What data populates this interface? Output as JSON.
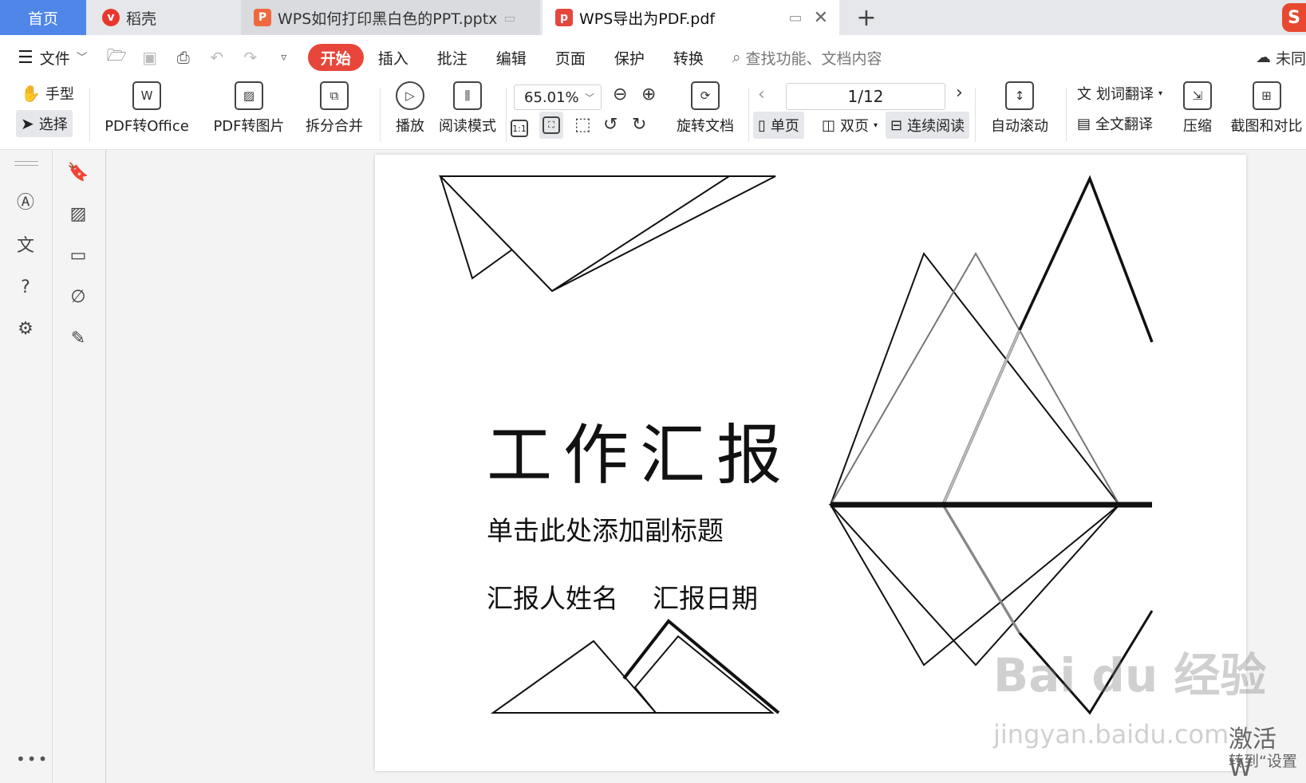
{
  "tabs": {
    "home": "首页",
    "daoke": "稻壳",
    "pptx": "WPS如何打印黑白色的PPT.pptx",
    "pdf": "WPS导出为PDF.pdf",
    "new_tab": "+"
  },
  "menu": {
    "file": "文件",
    "items": [
      "开始",
      "插入",
      "批注",
      "编辑",
      "页面",
      "保护",
      "转换"
    ],
    "search_placeholder": "查找功能、文档内容",
    "cloud": "未同"
  },
  "ribbon": {
    "hand": "手型",
    "select": "选择",
    "pdf_to_office": "PDF转Office",
    "pdf_to_image": "PDF转图片",
    "split_merge": "拆分合并",
    "play": "播放",
    "read_mode": "阅读模式",
    "zoom": "65.01%",
    "rotate": "旋转文档",
    "page_indicator": "1/12",
    "single": "单页",
    "double": "双页",
    "continuous": "连续阅读",
    "auto_scroll": "自动滚动",
    "word_translate": "划词翻译",
    "full_translate": "全文翻译",
    "compress": "压缩",
    "screenshot_compare": "截图和对比",
    "fit_label": "1:1"
  },
  "slide": {
    "title": "工作汇报",
    "subtitle": "单击此处添加副标题",
    "reporter": "汇报人姓名",
    "date": "汇报日期"
  },
  "overlay": {
    "watermark": "Bai du 经验",
    "watermark_url": "jingyan.baidu.com",
    "activate": "激活 W",
    "activate_sub": "转到“设置"
  },
  "colors": {
    "home_tab": "#4f86e8",
    "accent": "#e8463a"
  }
}
